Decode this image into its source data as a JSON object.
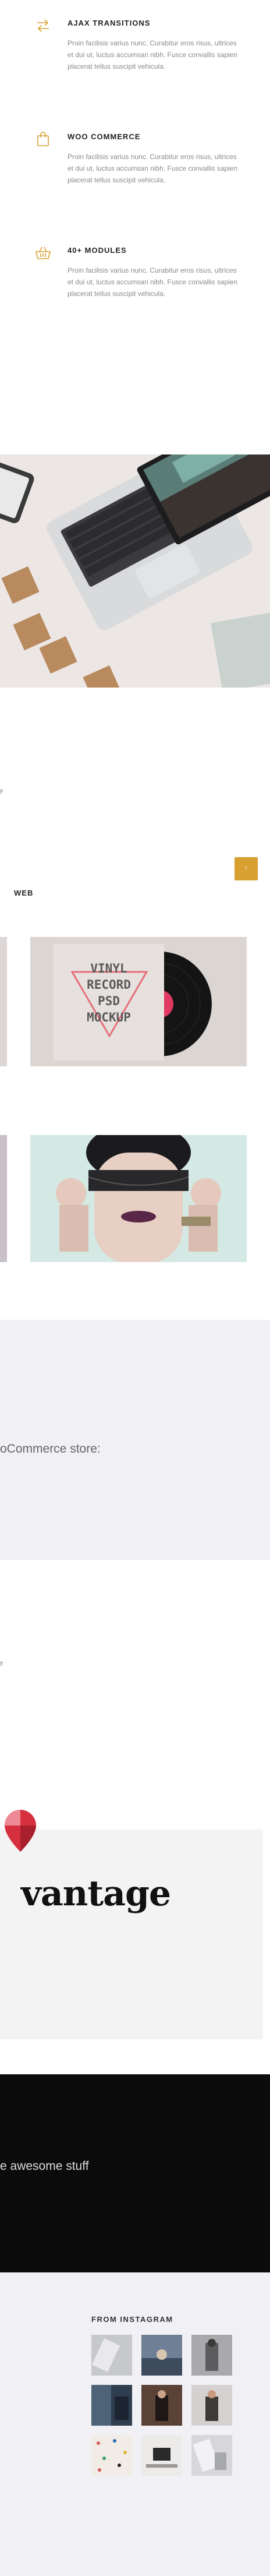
{
  "features": [
    {
      "icon": "swap-arrows-icon",
      "title": "AJAX TRANSITIONS",
      "text": "Proin facilisis varius nunc. Curabitur eros risus, ultrices et dui ut, luctus accumsan nibh. Fusce convallis sapien placerat tellus suscipit vehicula."
    },
    {
      "icon": "shopping-bag-icon",
      "title": "WOO COMMERCE",
      "text": "Proin facilisis varius nunc. Curabitur eros risus, ultrices et dui ut, luctus accumsan nibh. Fusce convallis sapien placerat tellus suscipit vehicula."
    },
    {
      "icon": "basket-icon",
      "title": "40+ MODULES",
      "text": "Proin facilisis varius nunc. Curabitur eros risus, ultrices et dui ut, luctus accumsan nibh. Fusce convallis sapien placerat tellus suscipit vehicula."
    }
  ],
  "marks": {
    "first": "y",
    "second": "y"
  },
  "back_to_top": {
    "icon": "arrow-up-icon",
    "glyph": "↑"
  },
  "portfolio": {
    "category": "WEB",
    "vinyl_lines": [
      "VINYL",
      "RECORD",
      "PSD",
      "MOCKUP"
    ]
  },
  "store_text": "oCommerce store:",
  "brand": {
    "word": "vantage"
  },
  "dark_text": "e awesome stuff",
  "instagram": {
    "title": "FROM INSTAGRAM",
    "thumbs": [
      "thumb-1",
      "thumb-2",
      "thumb-3",
      "thumb-4",
      "thumb-5",
      "thumb-6",
      "thumb-7",
      "thumb-8",
      "thumb-9"
    ]
  },
  "colors": {
    "accent": "#d8a030",
    "feature_icon": "#d8a030",
    "body_text": "#8a8a8a",
    "heading": "#222222",
    "dark_band": "#0b0b0b",
    "light_section": "#f1f1f5"
  }
}
